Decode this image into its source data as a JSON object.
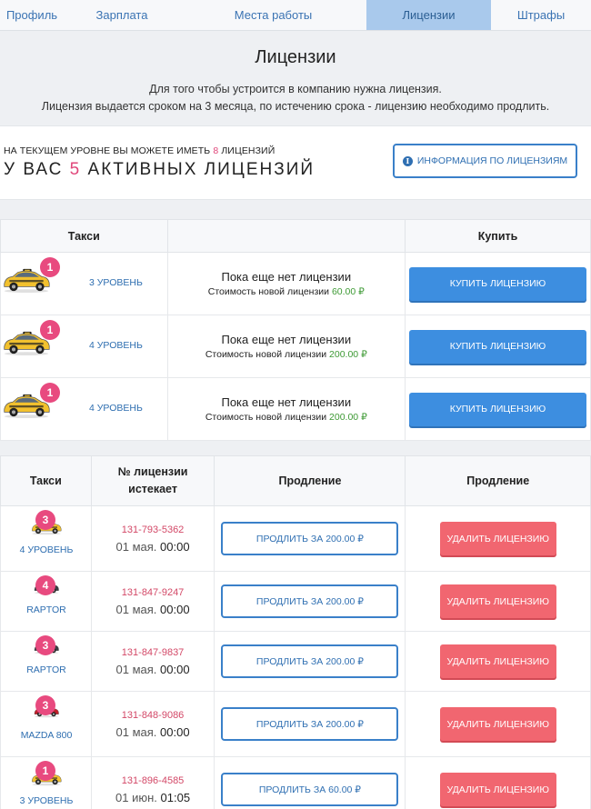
{
  "tabs": [
    {
      "label": "Профиль",
      "active": false
    },
    {
      "label": "Зарплата",
      "active": false
    },
    {
      "label": "Места работы",
      "active": false
    },
    {
      "label": "Лицензии",
      "active": true
    },
    {
      "label": "Штрафы",
      "active": false
    }
  ],
  "header": {
    "title": "Лицензии",
    "desc_line1": "Для того чтобы устроится в компанию нужна лицензия.",
    "desc_line2": "Лицензия выдается сроком на 3 месяца, по истечению срока - лицензию необходимо продлить."
  },
  "summary": {
    "line1_prefix": "На текущем уровне вы можете иметь",
    "max_licenses": "8",
    "line1_suffix": "лицензий",
    "line2_prefix": "У вас",
    "active_licenses": "5",
    "line2_suffix": "активных лицензий",
    "info_button": "Информация по лицензиям"
  },
  "shop": {
    "headers": {
      "taxi": "Такси",
      "status": "",
      "buy": "Купить"
    },
    "rows": [
      {
        "badge": "1",
        "level": "3 уровень",
        "status": "Пока еще нет лицензии",
        "cost_label": "Стоимость новой лицензии",
        "price": "60.00 ₽",
        "buy_label": "Купить лицензию",
        "car_color": "#f2c12e",
        "car_type": "sedan"
      },
      {
        "badge": "1",
        "level": "4 уровень",
        "status": "Пока еще нет лицензии",
        "cost_label": "Стоимость новой лицензии",
        "price": "200.00 ₽",
        "buy_label": "Купить лицензию",
        "car_color": "#f2c12e",
        "car_type": "hatch"
      },
      {
        "badge": "1",
        "level": "4 уровень",
        "status": "Пока еще нет лицензии",
        "cost_label": "Стоимость новой лицензии",
        "price": "200.00 ₽",
        "buy_label": "Купить лицензию",
        "car_color": "#f2c12e",
        "car_type": "hatch"
      }
    ]
  },
  "owned": {
    "headers": {
      "taxi": "Такси",
      "license": "№ лицензии истекает",
      "extend": "Продление",
      "delete": "Продление"
    },
    "rows": [
      {
        "badge": "3",
        "car_name": "4 уровень",
        "number": "131-793-5362",
        "date": "01 мая.",
        "time": "00:00",
        "extend_label": "Продлить за 200.00 ₽",
        "delete_label": "Удалить лицензию",
        "car_color": "#f2c12e"
      },
      {
        "badge": "4",
        "car_name": "Raptor",
        "number": "131-847-9247",
        "date": "01 мая.",
        "time": "00:00",
        "extend_label": "Продлить за 200.00 ₽",
        "delete_label": "Удалить лицензию",
        "car_color": "#3a3d44"
      },
      {
        "badge": "3",
        "car_name": "Raptor",
        "number": "131-847-9837",
        "date": "01 мая.",
        "time": "00:00",
        "extend_label": "Продлить за 200.00 ₽",
        "delete_label": "Удалить лицензию",
        "car_color": "#3a3d44"
      },
      {
        "badge": "3",
        "car_name": "Mazda 800",
        "number": "131-848-9086",
        "date": "01 мая.",
        "time": "00:00",
        "extend_label": "Продлить за 200.00 ₽",
        "delete_label": "Удалить лицензию",
        "car_color": "#c0202b"
      },
      {
        "badge": "1",
        "car_name": "3 уровень",
        "number": "131-896-4585",
        "date": "01 июн.",
        "time": "01:05",
        "extend_label": "Продлить за 60.00 ₽",
        "delete_label": "Удалить лицензию",
        "car_color": "#f2c12e"
      }
    ]
  }
}
